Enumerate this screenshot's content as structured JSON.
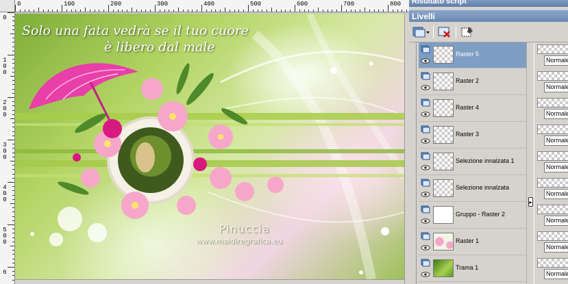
{
  "canvas": {
    "ruler_top_labels": [
      "0",
      "100",
      "200",
      "300",
      "400",
      "500",
      "600",
      "700",
      "800",
      "900"
    ],
    "ruler_left_labels": [
      "0",
      "1 0 0",
      "2 0 0",
      "3 0 0",
      "4 0 0",
      "5 0 0",
      "6"
    ],
    "artwork": {
      "title_line1": "Solo una fata vedrà se il tuo cuore",
      "title_line2": "è libero dal male",
      "signature": "Pinuccia",
      "url": "www.maidiregrafica.eu"
    }
  },
  "panels": {
    "script_title": "Risultato script",
    "layers_title": "Livelli"
  },
  "layers_toolbar": {
    "icons": [
      "new-layer-icon",
      "delete-layer-icon",
      "new-mask-icon"
    ]
  },
  "layers": [
    {
      "name": "Raster 5",
      "selected": true,
      "thumb": "empty",
      "blend": "Normale"
    },
    {
      "name": "Raster 2",
      "selected": false,
      "thumb": "flowers-small",
      "blend": "Normale"
    },
    {
      "name": "Raster 4",
      "selected": false,
      "thumb": "empty",
      "blend": "Normale"
    },
    {
      "name": "Raster 3",
      "selected": false,
      "thumb": "dots",
      "blend": "Normale"
    },
    {
      "name": "Selezione innalzata 1",
      "selected": false,
      "thumb": "dot-green",
      "blend": "Normale"
    },
    {
      "name": "Selezione innalzata",
      "selected": false,
      "thumb": "lines",
      "blend": "Normale"
    },
    {
      "name": "Gruppo - Raster 2",
      "selected": false,
      "thumb": "white",
      "blend": "Normale"
    },
    {
      "name": "Raster 1",
      "selected": false,
      "thumb": "flowers",
      "blend": "Normale"
    },
    {
      "name": "Trama 1",
      "selected": false,
      "thumb": "green",
      "blend": "Normale"
    }
  ],
  "colors": {
    "panel_bg": "#d6d3ce",
    "title_bar": "#6a89b2",
    "selected_row": "#7e9ec4",
    "art_pink": "#e83fa8",
    "art_green": "#9ec25a"
  }
}
